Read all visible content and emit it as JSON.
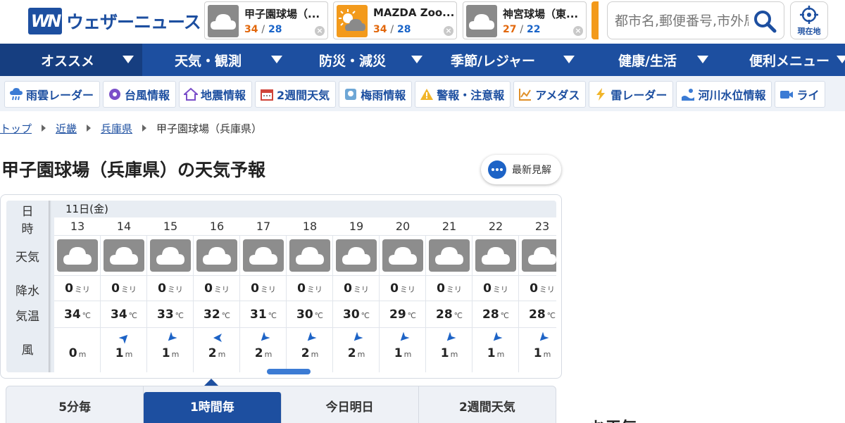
{
  "brand": {
    "logo_mark": "WN",
    "name": "ウェザーニュース",
    "color": "#1d4fa0"
  },
  "favorites": [
    {
      "name": "甲子園球場（...",
      "hi": "34",
      "lo": "28",
      "icon": "cloudy-icon"
    },
    {
      "name": "MAZDA Zoo...",
      "hi": "34",
      "lo": "28",
      "icon": "sunny-cloudy-icon"
    },
    {
      "name": "神宮球場（東...",
      "hi": "27",
      "lo": "22",
      "icon": "cloudy-icon"
    }
  ],
  "temp_sep": "/",
  "search": {
    "placeholder": "都市名,郵便番号,市外局番"
  },
  "locate": {
    "label": "現在地"
  },
  "main_nav": [
    {
      "label": "オススメ",
      "active": true
    },
    {
      "label": "天気・観測"
    },
    {
      "label": "防災・減災"
    },
    {
      "label": "季節/レジャー"
    },
    {
      "label": "健康/生活"
    },
    {
      "label": "便利メニュー"
    }
  ],
  "sub_nav": [
    {
      "label": "雨雲レーダー",
      "icon": "rain-radar-icon"
    },
    {
      "label": "台風情報",
      "icon": "typhoon-icon"
    },
    {
      "label": "地震情報",
      "icon": "earthquake-icon"
    },
    {
      "label": "2週間天気",
      "icon": "calendar-icon"
    },
    {
      "label": "梅雨情報",
      "icon": "rainy-season-icon"
    },
    {
      "label": "警報・注意報",
      "icon": "warning-icon"
    },
    {
      "label": "アメダス",
      "icon": "amedas-chart-icon"
    },
    {
      "label": "雷レーダー",
      "icon": "lightning-icon"
    },
    {
      "label": "河川水位情報",
      "icon": "river-icon"
    },
    {
      "label": "ライ",
      "icon": "camera-icon"
    }
  ],
  "breadcrumb": {
    "top": "トップ",
    "region": "近畿",
    "prefecture": "兵庫県",
    "current": "甲子園球場（兵庫県）"
  },
  "page_title": "甲子園球場（兵庫県）の天気予報",
  "latest_button": {
    "label": "最新見解"
  },
  "forecast": {
    "row_labels": {
      "day": "日",
      "hour": "時",
      "weather": "天気",
      "rain": "降水",
      "temp": "気温",
      "wind": "風"
    },
    "day": "11日(金)",
    "rain_unit": "ミリ",
    "temp_unit": "℃",
    "wind_unit": "m",
    "hours": [
      {
        "hour": "13",
        "rain": "0",
        "temp": "34",
        "wind": "0",
        "wind_dir": "none"
      },
      {
        "hour": "14",
        "rain": "0",
        "temp": "34",
        "wind": "1",
        "wind_dir": "ne"
      },
      {
        "hour": "15",
        "rain": "0",
        "temp": "33",
        "wind": "1",
        "wind_dir": "sw"
      },
      {
        "hour": "16",
        "rain": "0",
        "temp": "32",
        "wind": "2",
        "wind_dir": "w"
      },
      {
        "hour": "17",
        "rain": "0",
        "temp": "31",
        "wind": "2",
        "wind_dir": "sw"
      },
      {
        "hour": "18",
        "rain": "0",
        "temp": "30",
        "wind": "2",
        "wind_dir": "sw"
      },
      {
        "hour": "19",
        "rain": "0",
        "temp": "30",
        "wind": "2",
        "wind_dir": "sw"
      },
      {
        "hour": "20",
        "rain": "0",
        "temp": "29",
        "wind": "1",
        "wind_dir": "sw"
      },
      {
        "hour": "21",
        "rain": "0",
        "temp": "28",
        "wind": "1",
        "wind_dir": "sw"
      },
      {
        "hour": "22",
        "rain": "0",
        "temp": "28",
        "wind": "1",
        "wind_dir": "sw"
      },
      {
        "hour": "23",
        "rain": "0",
        "temp": "28",
        "wind": "1",
        "wind_dir": "sw"
      }
    ],
    "weather_icon": "cloudy-icon",
    "scroll_position": 0.45
  },
  "tabs": [
    {
      "label": "5分毎"
    },
    {
      "label": "1時間毎",
      "active": true
    },
    {
      "label": "今日明日"
    },
    {
      "label": "2週間天気"
    }
  ],
  "side_heading_peek": "お天気"
}
